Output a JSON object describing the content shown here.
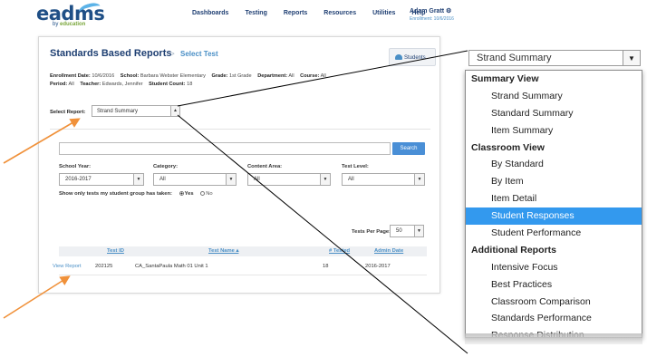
{
  "header": {
    "logo_text": "eadms",
    "logo_sub_prefix": "by",
    "logo_sub_brand": "education",
    "nav": [
      "Dashboards",
      "Testing",
      "Reports",
      "Resources",
      "Utilities",
      "Help"
    ],
    "user_name": "Adam Gratt ⚙",
    "user_enrollment": "Enrollment: 10/6/2016"
  },
  "page": {
    "title": "Standards Based Reports",
    "breadcrumb_sep": ">",
    "breadcrumb_current": "Select Test",
    "students_button": "Students"
  },
  "info": {
    "enrollment_date_label": "Enrollment Date:",
    "enrollment_date": "10/6/2016",
    "school_label": "School:",
    "school": "Barbara Webster Elementary",
    "grade_label": "Grade:",
    "grade": "1st Grade",
    "department_label": "Department:",
    "department": "All",
    "course_label": "Course:",
    "course": "All",
    "period_label": "Period:",
    "period": "All",
    "teacher_label": "Teacher:",
    "teacher": "Edwards, Jennifer",
    "student_count_label": "Student Count:",
    "student_count": "18"
  },
  "select_report": {
    "label": "Select Report:",
    "value": "Strand Summary"
  },
  "search": {
    "placeholder": "",
    "button": "Search"
  },
  "filters": [
    {
      "label": "School Year:",
      "value": "2016-2017"
    },
    {
      "label": "Category:",
      "value": "All"
    },
    {
      "label": "Content Area:",
      "value": "All"
    },
    {
      "label": "Test Level:",
      "value": "All"
    }
  ],
  "only_tests": {
    "label": "Show only tests my student group has taken:",
    "yes": "Yes",
    "no": "No"
  },
  "tests_per_page": {
    "label": "Tests Per Page:",
    "value": "50"
  },
  "table": {
    "headers": [
      "Test ID",
      "Test Name ▴",
      "# Tested",
      "Admin Date"
    ],
    "rows": [
      {
        "action": "View Report",
        "test_id": "202125",
        "test_name": "CA_SantaPaula Math 01 Unit 1",
        "tested": "18",
        "admin_date": "2016-2017"
      }
    ]
  },
  "zoom_dropdown": {
    "value": "Strand Summary",
    "items": [
      {
        "text": "Summary View",
        "kind": "group"
      },
      {
        "text": "Strand Summary",
        "kind": "option"
      },
      {
        "text": "Standard Summary",
        "kind": "option"
      },
      {
        "text": "Item Summary",
        "kind": "option"
      },
      {
        "text": "Classroom View",
        "kind": "group"
      },
      {
        "text": "By Standard",
        "kind": "option"
      },
      {
        "text": "By Item",
        "kind": "option"
      },
      {
        "text": "Item Detail",
        "kind": "option"
      },
      {
        "text": "Student Responses",
        "kind": "option",
        "selected": true
      },
      {
        "text": "Student Performance",
        "kind": "option"
      },
      {
        "text": "Additional Reports",
        "kind": "group"
      },
      {
        "text": "Intensive Focus",
        "kind": "option"
      },
      {
        "text": "Best Practices",
        "kind": "option"
      },
      {
        "text": "Classroom Comparison",
        "kind": "option"
      },
      {
        "text": "Standards Performance",
        "kind": "option"
      },
      {
        "text": "Response Distribution",
        "kind": "option"
      }
    ]
  },
  "colors": {
    "brand_navy": "#1e3f72",
    "link_blue": "#4a8fc6",
    "highlight_blue": "#3399ee",
    "arrow_orange": "#f0913a"
  }
}
